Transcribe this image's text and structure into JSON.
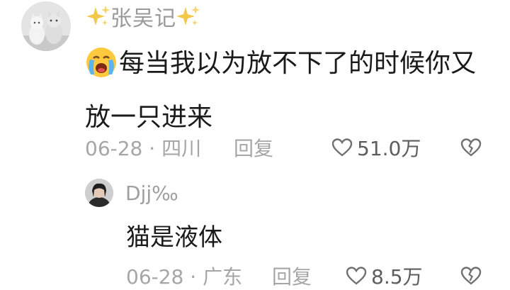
{
  "comment": {
    "username": "张吴记",
    "text": "每当我以为放不下了的时候你又放一只进来",
    "date": "06-28 · 四川",
    "reply_label": "回复",
    "likes": "51.0万"
  },
  "reply": {
    "username": "Djj‰",
    "text": "猫是液体",
    "date": "06-28 · 广东",
    "reply_label": "回复",
    "likes": "8.5万"
  },
  "colors": {
    "text": "#1a1a1a",
    "meta": "#a6a6a6",
    "sparkle": "#f2c84b"
  }
}
